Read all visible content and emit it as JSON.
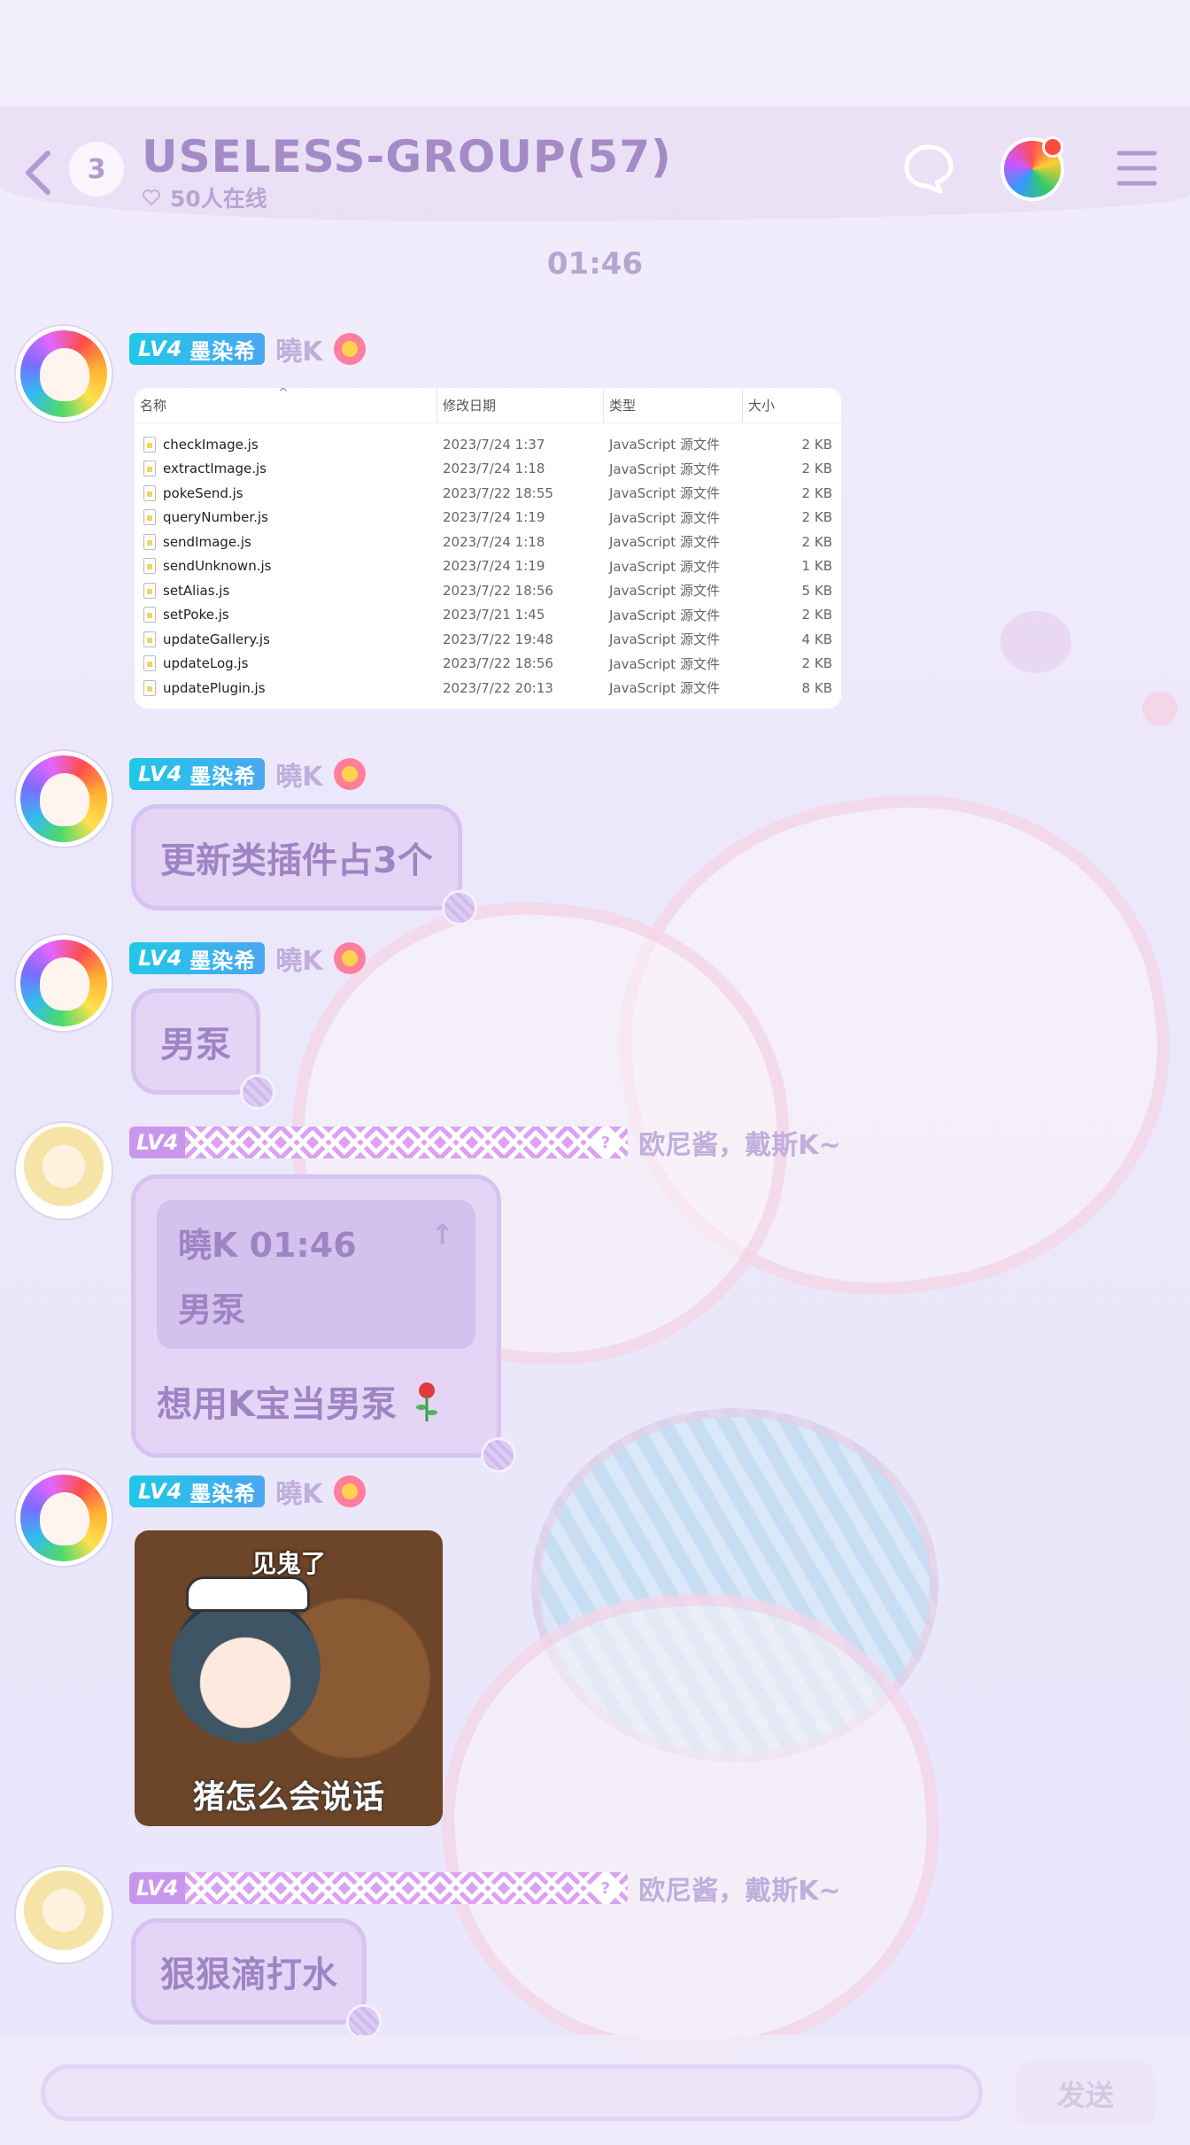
{
  "header": {
    "unread_count": "3",
    "group_title": "USELESS-GROUP(57)",
    "online_text": "50人在线"
  },
  "timestamp": "01:46",
  "file_table": {
    "columns": [
      "名称",
      "修改日期",
      "类型",
      "大小"
    ],
    "rows": [
      {
        "name": "checkImage.js",
        "date": "2023/7/24 1:37",
        "type": "JavaScript 源文件",
        "size": "2 KB"
      },
      {
        "name": "extractImage.js",
        "date": "2023/7/24 1:18",
        "type": "JavaScript 源文件",
        "size": "2 KB"
      },
      {
        "name": "pokeSend.js",
        "date": "2023/7/22 18:55",
        "type": "JavaScript 源文件",
        "size": "2 KB"
      },
      {
        "name": "queryNumber.js",
        "date": "2023/7/24 1:19",
        "type": "JavaScript 源文件",
        "size": "2 KB"
      },
      {
        "name": "sendImage.js",
        "date": "2023/7/24 1:18",
        "type": "JavaScript 源文件",
        "size": "2 KB"
      },
      {
        "name": "sendUnknown.js",
        "date": "2023/7/24 1:19",
        "type": "JavaScript 源文件",
        "size": "1 KB"
      },
      {
        "name": "setAlias.js",
        "date": "2023/7/22 18:56",
        "type": "JavaScript 源文件",
        "size": "5 KB"
      },
      {
        "name": "setPoke.js",
        "date": "2023/7/21 1:45",
        "type": "JavaScript 源文件",
        "size": "2 KB"
      },
      {
        "name": "updateGallery.js",
        "date": "2023/7/22 19:48",
        "type": "JavaScript 源文件",
        "size": "4 KB"
      },
      {
        "name": "updateLog.js",
        "date": "2023/7/22 18:56",
        "type": "JavaScript 源文件",
        "size": "2 KB"
      },
      {
        "name": "updatePlugin.js",
        "date": "2023/7/22 20:13",
        "type": "JavaScript 源文件",
        "size": "8 KB"
      }
    ]
  },
  "messages": [
    {
      "level": "LV4",
      "title": "墨染希",
      "sender": "曉K"
    },
    {
      "level": "LV4",
      "title": "墨染希",
      "sender": "曉K",
      "text": "更新类插件占3个"
    },
    {
      "level": "LV4",
      "title": "墨染希",
      "sender": "曉K",
      "text": "男泵"
    },
    {
      "level": "LV4",
      "tag_q": "?",
      "sender": "欧尼酱，戴斯K~",
      "quote_header": "曉K 01:46",
      "quote_arrow": "↑",
      "quote_text": "男泵",
      "text": "想用K宝当男泵"
    },
    {
      "level": "LV4",
      "title": "墨染希",
      "sender": "曉K",
      "sticker_top": "见鬼了",
      "sticker_bottom": "猪怎么会说话"
    },
    {
      "level": "LV4",
      "tag_q": "?",
      "sender": "欧尼酱，戴斯K~",
      "text": "狠狠滴打水"
    }
  ],
  "input": {
    "value": "",
    "send_label": "发送"
  },
  "colors": {
    "accent": "#a48bc6",
    "bubble": "#e4d5f6",
    "tag_cyan": "#20c8e8",
    "tag_purple": "#c996ee",
    "unread_dot": "#ff4b3e"
  }
}
